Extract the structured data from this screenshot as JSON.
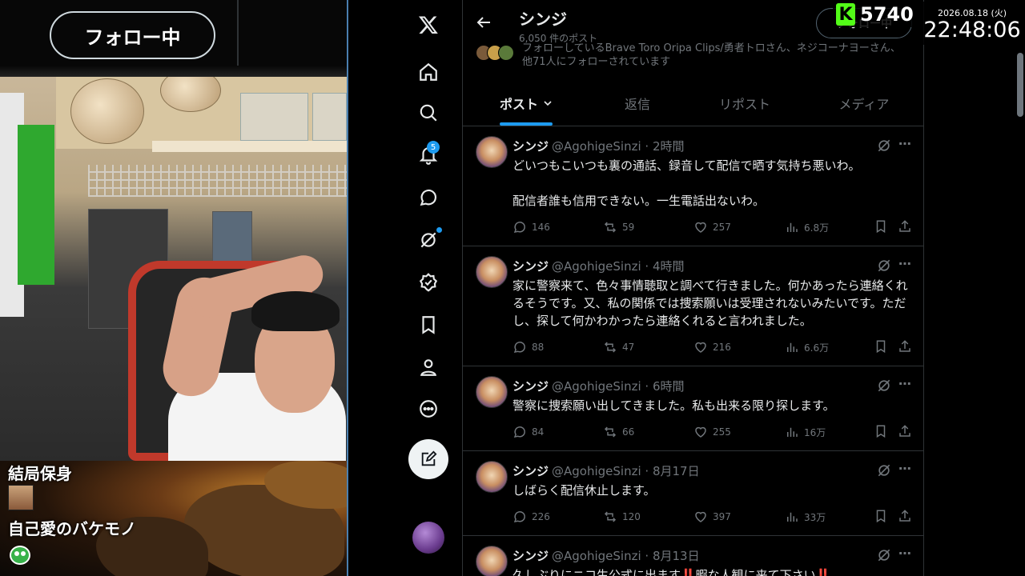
{
  "stream": {
    "follow_button": "フォロー中",
    "overlay_line_1": "結局保身",
    "overlay_line_2": "自己愛のバケモノ",
    "viewer_count": "5740",
    "clock_date": "2026.08.18 (火)",
    "clock_time": "22:48:06"
  },
  "nav": {
    "icons": [
      "x-logo-icon",
      "home-icon",
      "search-icon",
      "notifications-icon",
      "messages-icon",
      "grok-icon",
      "verified-icon",
      "bookmarks-icon",
      "profile-icon",
      "more-icon",
      "compose-icon"
    ],
    "notification_badge": "5"
  },
  "profile_header": {
    "name": "シンジ",
    "post_count": "6,050 件のポスト",
    "follow_button": "フォロー中",
    "followed_by": "フォローしているBrave Toro Oripa Clips/勇者トロさん、ネジコーナヨーさん、他71人にフォローされています"
  },
  "tabs": [
    {
      "label": "ポスト",
      "active": true
    },
    {
      "label": "返信",
      "active": false
    },
    {
      "label": "リポスト",
      "active": false
    },
    {
      "label": "メディア",
      "active": false
    }
  ],
  "posts": [
    {
      "name": "シンジ",
      "handle": "@AgohigeSinzi · 2時間",
      "text": "どいつもこいつも裏の通話、録音して配信で晒す気持ち悪いわ。\n\n配信者誰も信用できない。一生電話出ないわ。",
      "replies": "146",
      "reposts": "59",
      "likes": "257",
      "views": "6.8万"
    },
    {
      "name": "シンジ",
      "handle": "@AgohigeSinzi · 4時間",
      "text": "家に警察来て、色々事情聴取と調べて行きました。何かあったら連絡くれるそうです。又、私の関係では捜索願いは受理されないみたいです。ただし、探して何かわかったら連絡くれると言われました。",
      "replies": "88",
      "reposts": "47",
      "likes": "216",
      "views": "6.6万"
    },
    {
      "name": "シンジ",
      "handle": "@AgohigeSinzi · 6時間",
      "text": "警察に捜索願い出してきました。私も出来る限り探します。",
      "replies": "84",
      "reposts": "66",
      "likes": "255",
      "views": "16万"
    },
    {
      "name": "シンジ",
      "handle": "@AgohigeSinzi · 8月17日",
      "text": "しばらく配信休止します。",
      "replies": "226",
      "reposts": "120",
      "likes": "397",
      "views": "33万"
    },
    {
      "name": "シンジ",
      "handle": "@AgohigeSinzi · 8月13日",
      "text": "久しぶりにニコ生公式に出ます‼️暇な人観に来て下さい‼️",
      "replies": "",
      "reposts": "",
      "likes": "",
      "views": ""
    }
  ]
}
